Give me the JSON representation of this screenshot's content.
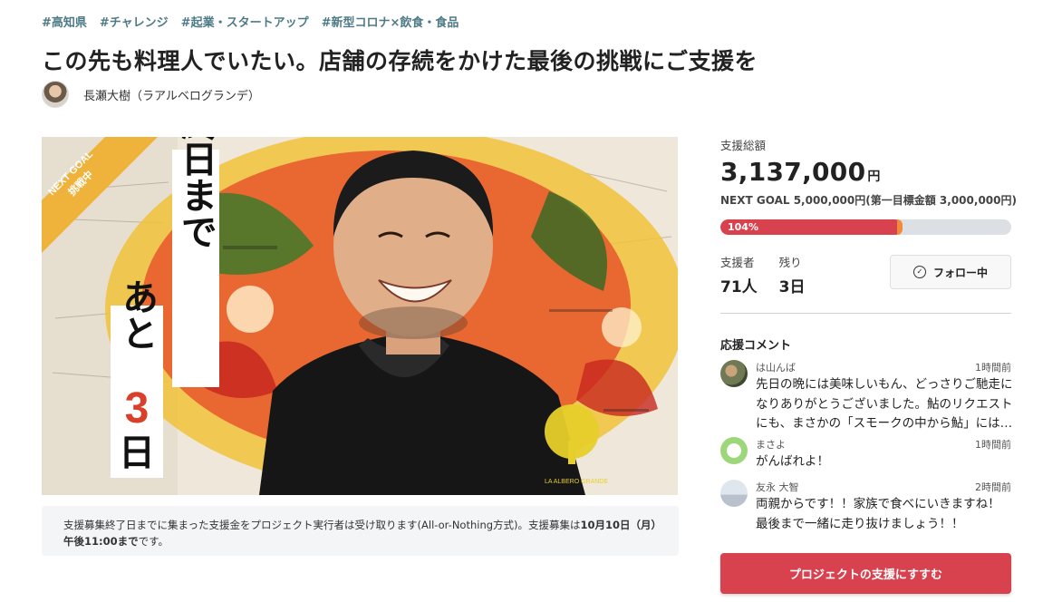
{
  "tags": [
    "#高知県",
    "#チャレンジ",
    "#起業・スタートアップ",
    "#新型コロナ×飲食・食品"
  ],
  "project": {
    "title": "この先も料理人でいたい。店舗の存続をかけた最後の挑戦にご支援を",
    "owner_name": "長瀬大樹（ラアルベログランデ）"
  },
  "hero": {
    "ribbon_line1": "NEXT GOAL",
    "ribbon_line2": "挑戦中",
    "banner_line1": "最終日まで",
    "banner_prefix": "あと",
    "banner_number": "3",
    "banner_suffix": "日",
    "logo_text": "LA ALBERO GRANDE"
  },
  "notice": {
    "text": "支援募集終了日までに集まった支援金をプロジェクト実行者は受け取ります(All-or-Nothing方式)。支援募集は",
    "deadline": "10月10日（月）午後11:00まで",
    "suffix": "です。"
  },
  "funding": {
    "total_label": "支援総額",
    "total_amount": "3,137,000",
    "currency_unit": "円",
    "next_goal_text": "NEXT GOAL 5,000,000円(第一目標金額 3,000,000円)",
    "progress_label": "104%",
    "progress_fraction": 0.627,
    "supporters_label": "支援者",
    "supporters_value": "71人",
    "remaining_label": "残り",
    "remaining_value": "3日",
    "follow_label": "フォロー中"
  },
  "comments": {
    "title": "応援コメント",
    "items": [
      {
        "name": "は山んば",
        "time": "1時間前",
        "lines": [
          "先日の晩には美味しいもん、どっさりご馳走に",
          "なりありがとうございました。鮎のリクエスト",
          "にも、まさかの「スモークの中から鮎」には…"
        ]
      },
      {
        "name": "まさよ",
        "time": "1時間前",
        "lines": [
          "がんばれよ！"
        ]
      },
      {
        "name": "友永 大智",
        "time": "2時間前",
        "lines": [
          "両親からです！！家族で食べにいきますね！",
          "最後まで一緒に走り抜けましょう！！"
        ]
      }
    ]
  },
  "cta": {
    "label": "プロジェクトの支援にすすむ"
  },
  "colors": {
    "accent": "#d8424f",
    "tag": "#4d7a86",
    "ribbon": "#efb23a",
    "progress_tip": "#f28a3c"
  }
}
